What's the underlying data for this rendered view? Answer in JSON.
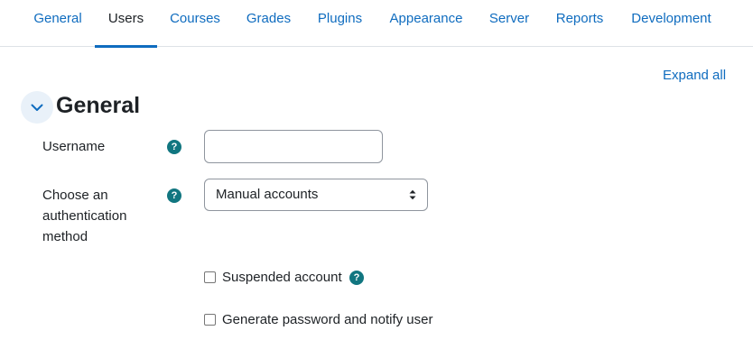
{
  "tabs": [
    {
      "label": "General",
      "active": false
    },
    {
      "label": "Users",
      "active": true
    },
    {
      "label": "Courses",
      "active": false
    },
    {
      "label": "Grades",
      "active": false
    },
    {
      "label": "Plugins",
      "active": false
    },
    {
      "label": "Appearance",
      "active": false
    },
    {
      "label": "Server",
      "active": false
    },
    {
      "label": "Reports",
      "active": false
    },
    {
      "label": "Development",
      "active": false
    }
  ],
  "expand_all": "Expand all",
  "section": {
    "title": "General",
    "toggle_icon": "chevron-down-icon"
  },
  "form": {
    "username": {
      "label": "Username",
      "value": "",
      "placeholder": "",
      "help_icon": "help-icon"
    },
    "auth": {
      "label_lines": [
        "Choose an",
        "authentication",
        "method"
      ],
      "selected": "Manual accounts",
      "help_icon": "help-icon"
    },
    "suspended": {
      "label": "Suspended account",
      "checked": false,
      "help_icon": "help-icon"
    },
    "generate_password": {
      "label": "Generate password and notify user",
      "checked": false
    }
  },
  "colors": {
    "link": "#0f6cbf",
    "text": "#1d2125",
    "help_badge": "#117680",
    "toggle_bg": "#e9f1f9"
  }
}
